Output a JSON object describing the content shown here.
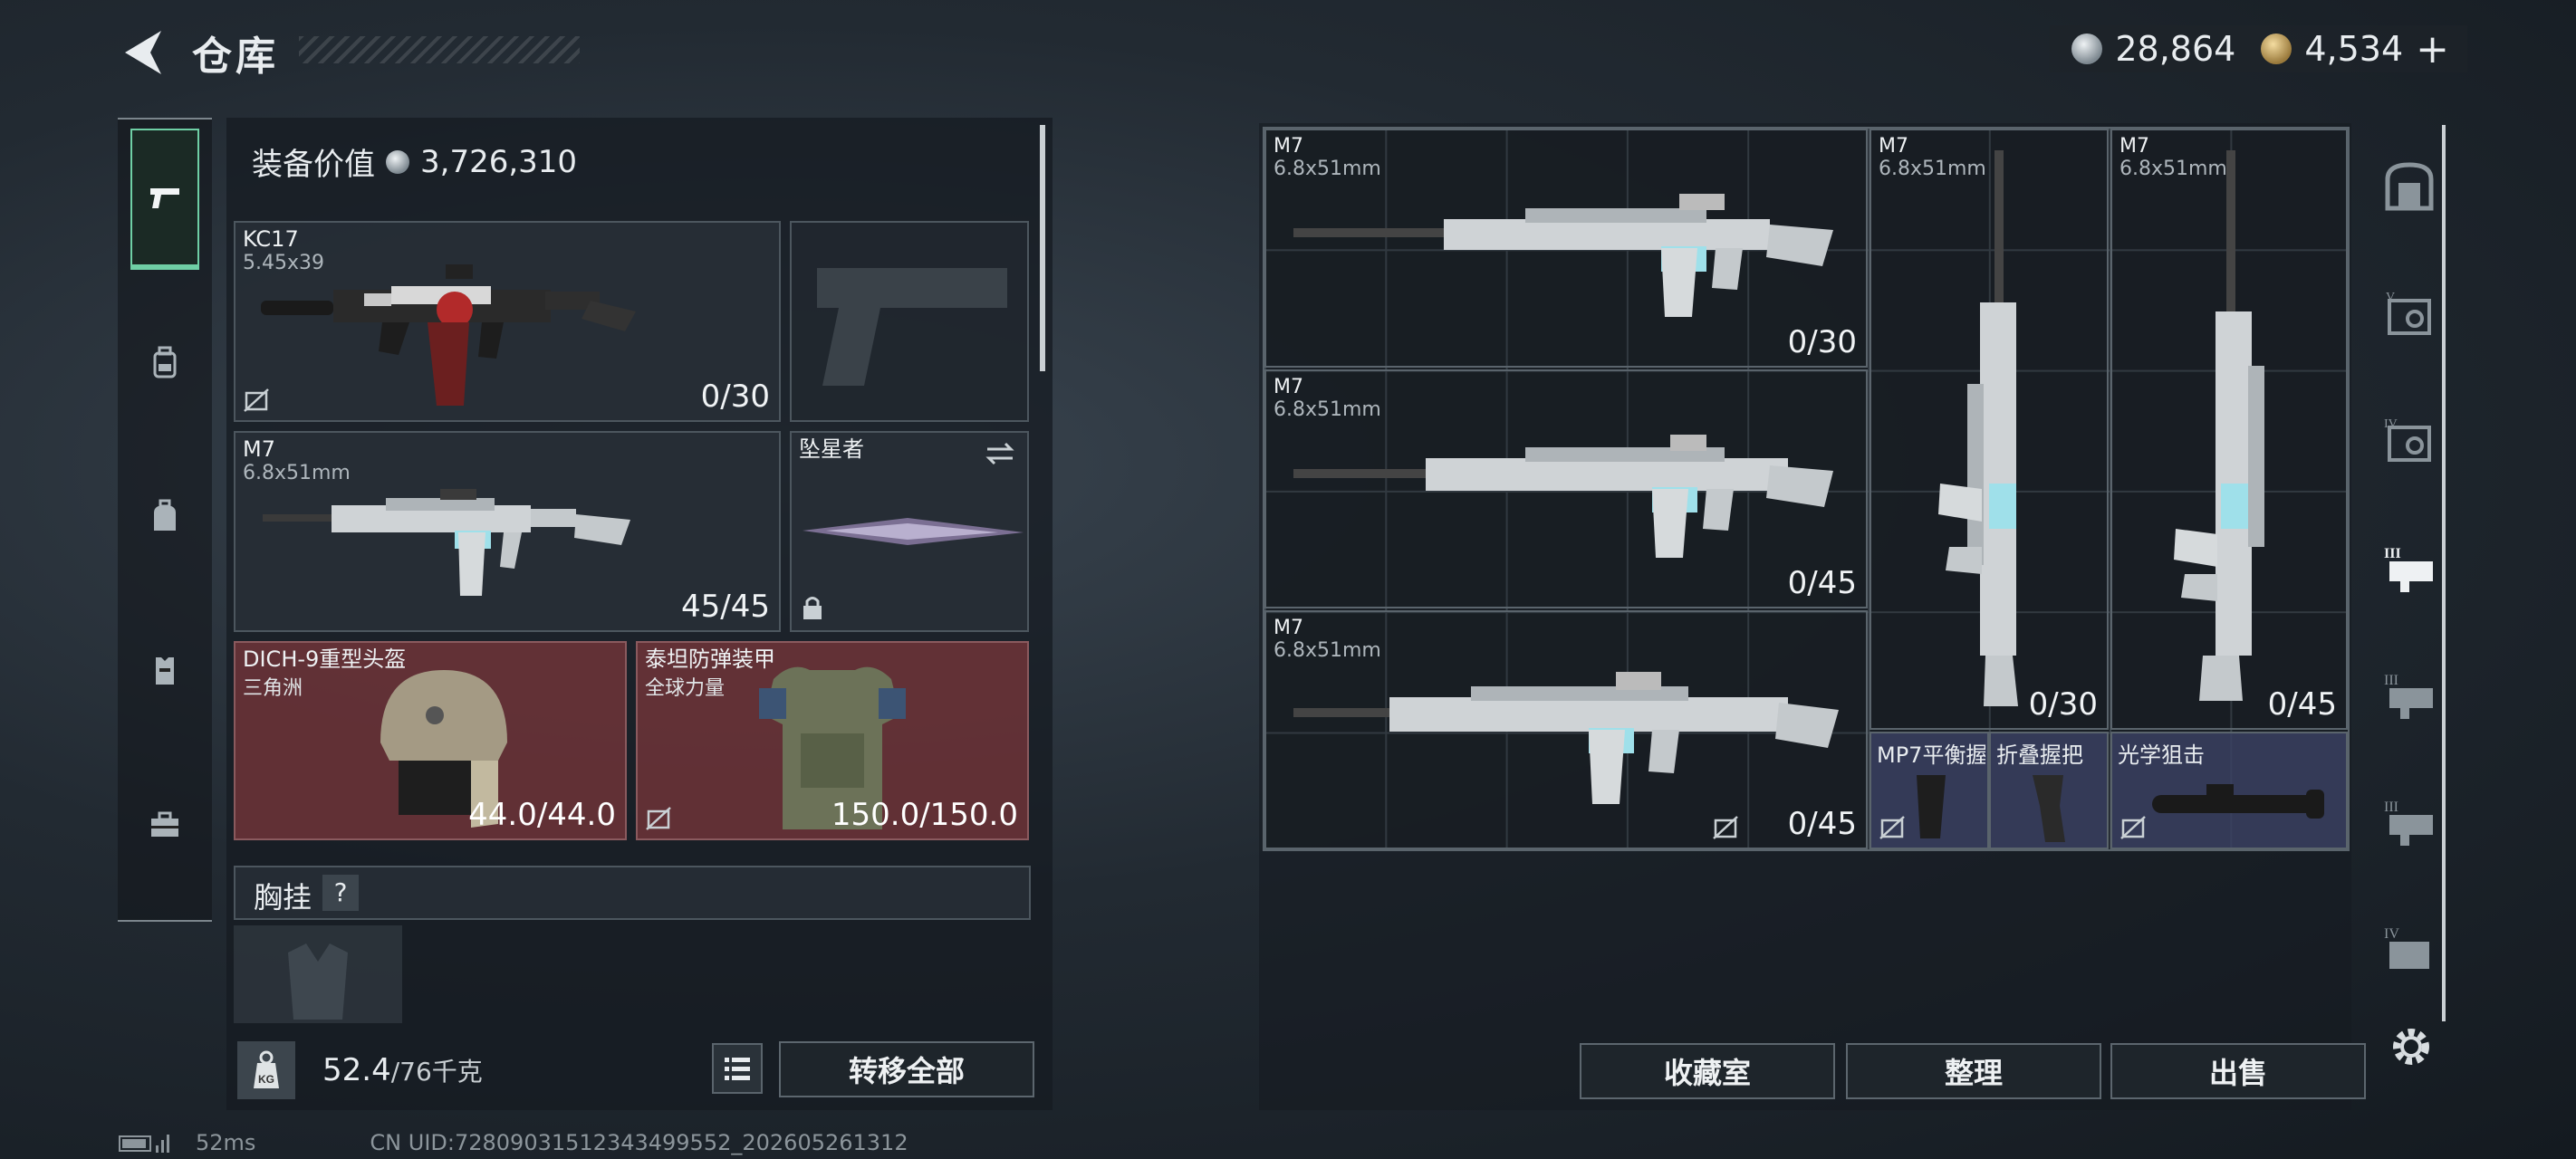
{
  "header": {
    "back_icon": "back-arrow-icon",
    "title": "仓库"
  },
  "currency": [
    {
      "icon": "silver-coin-icon",
      "value": "28,864"
    },
    {
      "icon": "gold-coin-icon",
      "value": "4,534"
    },
    {
      "add_label": "+"
    }
  ],
  "leftnav": {
    "items": [
      {
        "name": "pistol-icon",
        "active": true
      },
      {
        "name": "backpack-light-icon",
        "active": false
      },
      {
        "name": "backpack-icon",
        "active": false
      },
      {
        "name": "vest-icon",
        "active": false
      },
      {
        "name": "toolbox-icon",
        "active": false
      }
    ]
  },
  "loadout": {
    "equip_value_label": "装备价值",
    "equip_value": "3,726,310",
    "primary": {
      "name": "KC17",
      "caliber": "5.45x39",
      "ammo": "0/30"
    },
    "pistol_slot": {
      "placeholder_icon": "pistol-silhouette-icon"
    },
    "secondary": {
      "name": "M7",
      "caliber": "6.8x51mm",
      "ammo": "45/45"
    },
    "melee": {
      "name": "坠星者",
      "swap_icon": "swap-icon",
      "lock_icon": "lock-icon"
    },
    "helmet": {
      "name": "DICH-9重型头盔",
      "sub": "三角洲",
      "durability": "44.0/44.0"
    },
    "armor": {
      "name": "泰坦防弹装甲",
      "sub": "全球力量",
      "durability": "150.0/150.0"
    },
    "chest_rig": {
      "label": "胸挂",
      "help": "?"
    },
    "weight": {
      "value": "52.4",
      "unit": "/76千克",
      "icon": "kg-weight-icon"
    },
    "list_icon": "list-icon",
    "transfer_all": "转移全部"
  },
  "storage": {
    "items": [
      {
        "name": "M7",
        "caliber": "6.8x51mm",
        "ammo": "0/30"
      },
      {
        "name": "M7",
        "caliber": "6.8x51mm",
        "ammo": "0/45"
      },
      {
        "name": "M7",
        "caliber": "6.8x51mm",
        "ammo": "0/45"
      },
      {
        "name": "M7",
        "caliber": "6.8x51mm",
        "ammo": "0/30"
      },
      {
        "name": "M7",
        "caliber": "6.8x51mm",
        "ammo": "0/45"
      }
    ],
    "attachments": [
      {
        "name": "MP7平衡握把"
      },
      {
        "name": "折叠握把"
      },
      {
        "name": "光学狙击"
      }
    ],
    "buttons": {
      "collection": "收藏室",
      "organize": "整理",
      "sell": "出售"
    }
  },
  "rightnav": {
    "items": [
      "vault-icon",
      "case-v-icon",
      "case-iv-icon",
      "case-iii-active-icon",
      "case-iii-icon",
      "case-iii-b-icon",
      "case-iv-b-icon"
    ],
    "settings_icon": "gear-icon"
  },
  "footer": {
    "latency": "52ms",
    "uid": "CN UID:7280903151234349955​2_202605261312"
  }
}
